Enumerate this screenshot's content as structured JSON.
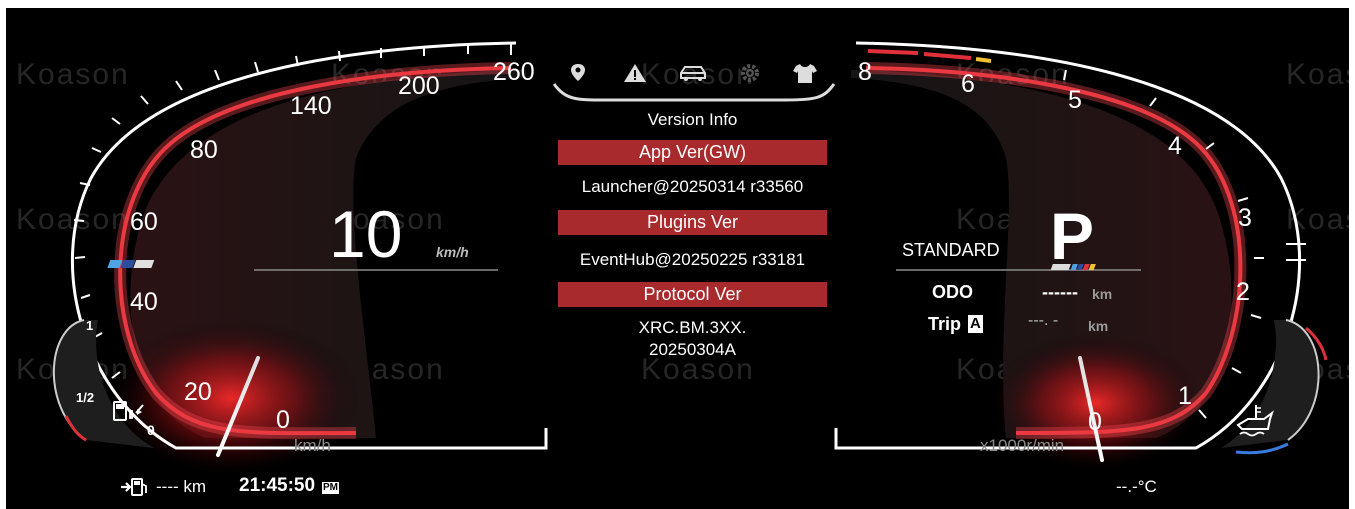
{
  "speedometer": {
    "ticks": [
      "260",
      "200",
      "140",
      "80",
      "60",
      "40",
      "20",
      "0"
    ],
    "speed_value": "10",
    "speed_unit": "km/h",
    "scale_unit": "km/h"
  },
  "tabs": [
    {
      "icon": "location-pin-icon"
    },
    {
      "icon": "warning-icon"
    },
    {
      "icon": "car-icon"
    },
    {
      "icon": "gear-icon"
    },
    {
      "icon": "shirt-icon"
    }
  ],
  "version_panel": {
    "title": "Version Info",
    "app_ver_label": "App Ver(GW)",
    "app_ver_value": "Launcher@20250314 r33560",
    "plugins_ver_label": "Plugins Ver",
    "plugins_ver_value": "EventHub@20250225 r33181",
    "protocol_ver_label": "Protocol Ver",
    "protocol_ver_line1": "XRC.BM.3XX.",
    "protocol_ver_line2": "20250304A"
  },
  "tachometer": {
    "ticks": [
      "8",
      "6",
      "5",
      "4",
      "3",
      "2",
      "1",
      "0"
    ],
    "unit": "x1000r/min"
  },
  "drive": {
    "mode": "STANDARD",
    "gear": "P"
  },
  "odo": {
    "label": "ODO",
    "value": "------",
    "unit": "km"
  },
  "trip": {
    "label": "Trip",
    "badge": "A",
    "value": "---. -",
    "unit": "km"
  },
  "fuel_gauge": {
    "full": "1",
    "half": "1/2",
    "empty": "0"
  },
  "status_bar": {
    "range_value": "---- km",
    "clock": "21:45:50",
    "ampm": "PM",
    "temperature": "--.-°C"
  },
  "watermark": "Koason",
  "colors": {
    "accent_red": "#e0303a",
    "panel_button": "#a82a2d",
    "background": "#000000"
  }
}
